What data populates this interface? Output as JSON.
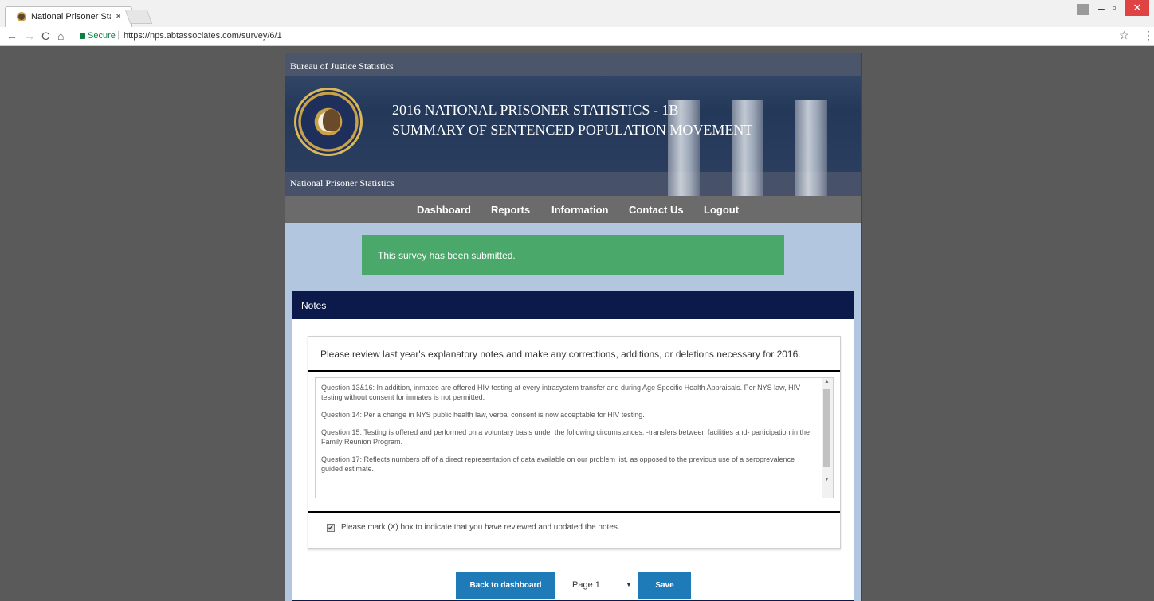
{
  "browser": {
    "tab_title": "National Prisoner Statis",
    "tab_close": "×",
    "secure_label": "Secure",
    "url": "https://nps.abtassociates.com/survey/6/1",
    "back": "←",
    "forward": "→",
    "reload": "C",
    "home": "⌂",
    "star": "☆",
    "menu": "⋮",
    "minimize": "–",
    "maximize": "▫",
    "close": "✕"
  },
  "banner": {
    "top_label": "Bureau of Justice Statistics",
    "bottom_label": "National Prisoner Statistics",
    "title_line1": "2016 NATIONAL PRISONER STATISTICS - 1B",
    "title_line2": "SUMMARY OF SENTENCED POPULATION MOVEMENT",
    "seal_icon": "department-of-justice-seal"
  },
  "nav": {
    "items": [
      "Dashboard",
      "Reports",
      "Information",
      "Contact Us",
      "Logout"
    ]
  },
  "alert": {
    "message": "This survey has been submitted.",
    "color": "#4aa96a"
  },
  "notes": {
    "header": "Notes",
    "instruction": "Please review last year's explanatory notes and make any corrections, additions, or deletions necessary for 2016.",
    "paragraphs": [
      "Question 13&16: In addition, inmates are offered HIV testing at every intrasystem transfer and during Age Specific Health Appraisals. Per NYS law, HIV testing without consent for inmates is not permitted.",
      "Question 14: Per a change in NYS public health law, verbal consent is now acceptable for HIV testing.",
      "Question 15: Testing is offered and performed on a voluntary basis under the following circumstances: -transfers between facilities and- participation in the Family Reunion Program.",
      "Question 17: Reflects numbers off of a direct representation of data available on our problem list, as opposed to the previous use of a seroprevalence guided estimate."
    ],
    "checkbox_checked": true,
    "checkbox_mark": "✔",
    "checkbox_label": "Please mark (X) box to indicate that you have reviewed and updated the notes."
  },
  "footer": {
    "back_button": "Back to dashboard",
    "page_select_value": "Page 1",
    "save_button": "Save",
    "button_color": "#1f7ab8"
  }
}
